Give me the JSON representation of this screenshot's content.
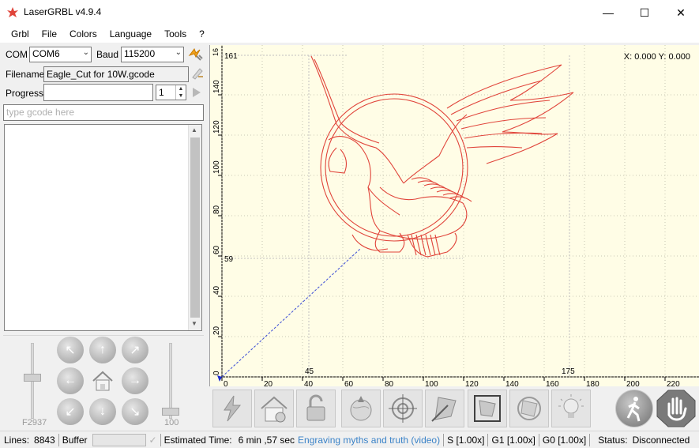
{
  "window": {
    "title": "LaserGRBL v4.9.4"
  },
  "window_controls": {
    "minimize": "—",
    "maximize": "☐",
    "close": "✕"
  },
  "menu": [
    "Grbl",
    "File",
    "Colors",
    "Language",
    "Tools",
    "?"
  ],
  "connection": {
    "com_label": "COM",
    "com_value": "COM6",
    "baud_label": "Baud",
    "baud_value": "115200"
  },
  "file": {
    "filename_label": "Filename",
    "filename_value": "Eagle_Cut for 10W.gcode"
  },
  "progress": {
    "label": "Progress",
    "count_value": "1"
  },
  "gcode_input": {
    "placeholder": "type gcode here"
  },
  "jog": {
    "feed_label": "F2937",
    "step_label": "100",
    "feed_level": 0.55,
    "step_level": 0.05
  },
  "canvas": {
    "coords": "X: 0.000 Y: 0.000",
    "x_ticks": [
      "0",
      "20",
      "40",
      "60",
      "80",
      "100",
      "120",
      "140",
      "160",
      "180",
      "200",
      "220"
    ],
    "y_ticks": [
      "0",
      "20",
      "40",
      "60",
      "80",
      "100",
      "120",
      "140"
    ],
    "x_markers": [
      "45",
      "175"
    ],
    "y_markers": [
      "161",
      "59"
    ],
    "y_top_partial": "16"
  },
  "toolbar": [
    "lightning-spark",
    "home",
    "unlock",
    "globe-center",
    "target-center",
    "frame-diagonal",
    "frame-box",
    "target-frame",
    "bulb",
    "walk",
    "stop-hand"
  ],
  "status": {
    "lines_label": "Lines:",
    "lines_value": "8843",
    "buffer_label": "Buffer",
    "time_label": "Estimated Time:",
    "time_value": "6 min ,57 sec",
    "link": "Engraving myths and truth (video)",
    "s_override": "S [1.00x]",
    "g1_override": "G1 [1.00x]",
    "g0_override": "G0 [1.00x]",
    "status_label": "Status:",
    "status_value": "Disconnected"
  },
  "colors": {
    "canvas_bg": "#fffde6",
    "path": "#e0443a",
    "grid": "#c8c8b4",
    "travel": "#3a4bd6"
  }
}
